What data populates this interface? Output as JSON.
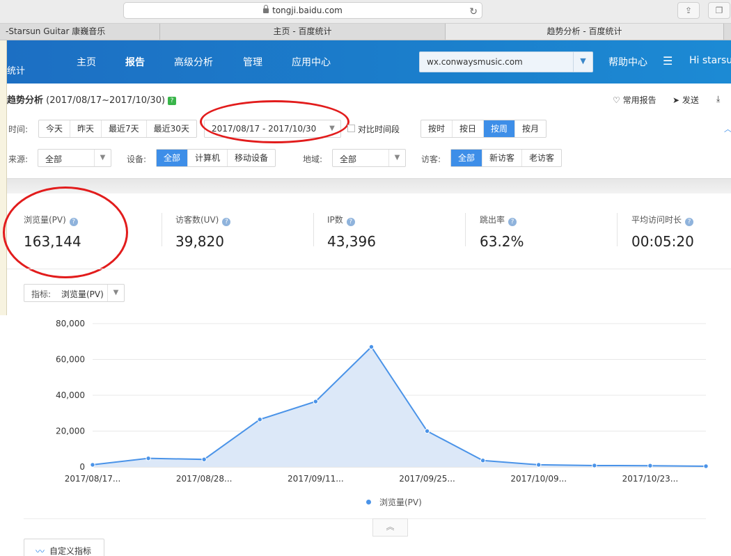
{
  "browser": {
    "url": "tongji.baidu.com"
  },
  "tabs": [
    {
      "label": "-Starsun Guitar 康巍音乐"
    },
    {
      "label": "主页 - 百度统计"
    },
    {
      "label": "趋势分析 - 百度统计"
    }
  ],
  "nav": {
    "brand": "统计",
    "items": [
      "主页",
      "报告",
      "高级分析",
      "管理",
      "应用中心"
    ],
    "active": "报告",
    "site": "wx.conwaysmusic.com",
    "help": "帮助中心",
    "user": "Hi  starsu"
  },
  "page": {
    "title": "趋势分析",
    "range": "(2017/08/17~2017/10/30)",
    "actions": [
      "常用报告",
      "发送",
      "下"
    ]
  },
  "filters": {
    "time_label": "时间:",
    "time_options": [
      "今天",
      "昨天",
      "最近7天",
      "最近30天"
    ],
    "date_range": "2017/08/17 - 2017/10/30",
    "compare_label": "对比时间段",
    "granularity": [
      "按时",
      "按日",
      "按周",
      "按月"
    ],
    "granularity_active": "按周",
    "source_label": "来源:",
    "source_value": "全部",
    "device_label": "设备:",
    "device_options": [
      "全部",
      "计算机",
      "移动设备"
    ],
    "region_label": "地域:",
    "region_value": "全部",
    "visitor_label": "访客:",
    "visitor_options": [
      "全部",
      "新访客",
      "老访客"
    ]
  },
  "stats": [
    {
      "label": "浏览量(PV)",
      "value": "163,144"
    },
    {
      "label": "访客数(UV)",
      "value": "39,820"
    },
    {
      "label": "IP数",
      "value": "43,396"
    },
    {
      "label": "跳出率",
      "value": "63.2%"
    },
    {
      "label": "平均访问时长",
      "value": "00:05:20"
    }
  ],
  "metric_select": {
    "label": "指标:",
    "value": "浏览量(PV)"
  },
  "chart_data": {
    "type": "area",
    "series": [
      {
        "name": "浏览量(PV)",
        "values": [
          1200,
          4800,
          4200,
          26500,
          36500,
          67000,
          20000,
          3600,
          1200,
          800,
          700,
          400
        ]
      }
    ],
    "x": [
      "2017/08/17",
      "2017/08/22",
      "2017/08/28",
      "2017/09/04",
      "2017/09/11",
      "2017/09/18",
      "2017/09/25",
      "2017/10/02",
      "2017/10/09",
      "2017/10/16",
      "2017/10/23",
      "2017/10/30"
    ],
    "tick_labels": [
      "2017/08/17...",
      "2017/08/28...",
      "2017/09/11...",
      "2017/09/25...",
      "2017/10/09...",
      "2017/10/23..."
    ],
    "y_ticks": [
      "0",
      "20,000",
      "40,000",
      "60,000",
      "80,000"
    ],
    "ylim": [
      0,
      80000
    ],
    "legend": "bottom-center",
    "grid": true,
    "color": "#4a93e8"
  },
  "bottom": {
    "custom_metric": "自定义指标",
    "collapse": "︽"
  },
  "colors": {
    "nav": "#1b7fcc",
    "accent": "#3d8ee8",
    "highlight": "#e21c1c"
  }
}
